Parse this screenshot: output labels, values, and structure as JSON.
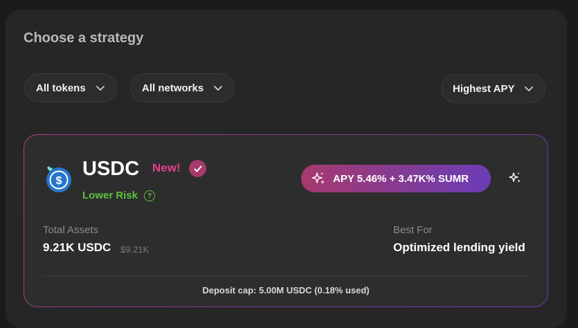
{
  "heading": "Choose a strategy",
  "filters": {
    "tokens_label": "All tokens",
    "networks_label": "All networks",
    "sort_label": "Highest APY"
  },
  "strategy": {
    "token": "USDC",
    "new_badge": "New!",
    "risk_label": "Lower Risk",
    "help_icon_glyph": "?",
    "apy_label": "APY 5.46% + 3.47K% SUMR",
    "total_assets_label": "Total Assets",
    "total_assets_value": "9.21K USDC",
    "total_assets_usd": "$9.21K",
    "best_for_label": "Best For",
    "best_for_value": "Optimized lending yield",
    "deposit_cap": "Deposit cap: 5.00M USDC (0.18% used)"
  },
  "colors": {
    "accent_pink": "#e0408b",
    "risk_green": "#5bc23d",
    "gradient_start": "#a8396e",
    "gradient_end": "#6b3cb6",
    "usdc_blue": "#2775ca"
  },
  "icons": [
    "chevron-down-icon",
    "usdc-logo-icon",
    "check-icon",
    "help-icon",
    "sparkles-icon"
  ]
}
